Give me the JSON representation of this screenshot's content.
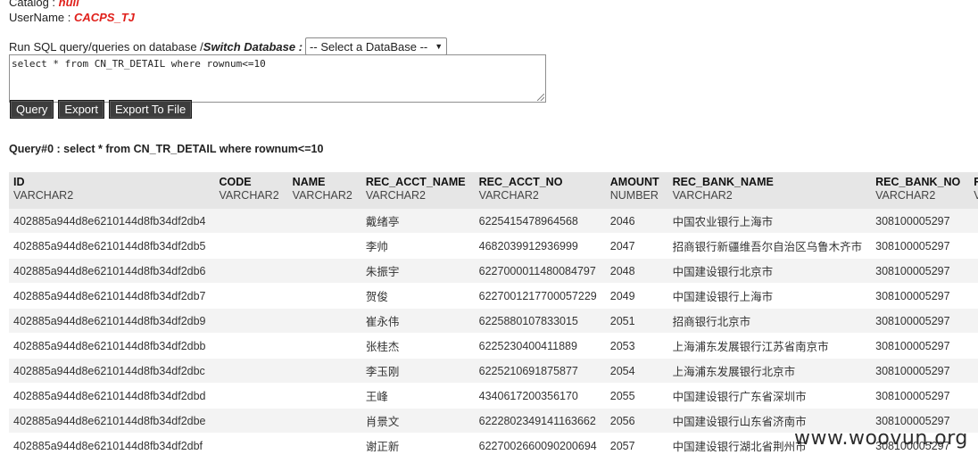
{
  "info": {
    "catalog_label": "Catalog : ",
    "catalog_value": "null",
    "username_label": "UserName : ",
    "username_value": "CACPS_TJ"
  },
  "run": {
    "label": "Run SQL query/queries on database / ",
    "switch_label": "Switch Database :",
    "select_value": "-- Select a DataBase --"
  },
  "sql": {
    "text": "select * from CN_TR_DETAIL where rownum<=10"
  },
  "buttons": {
    "query": "Query",
    "export": "Export",
    "export_file": "Export To File"
  },
  "query_title": "Query#0 : select * from CN_TR_DETAIL where rownum<=10",
  "table": {
    "columns": [
      {
        "name": "ID",
        "type": "VARCHAR2"
      },
      {
        "name": "CODE",
        "type": "VARCHAR2"
      },
      {
        "name": "NAME",
        "type": "VARCHAR2"
      },
      {
        "name": "REC_ACCT_NAME",
        "type": "VARCHAR2"
      },
      {
        "name": "REC_ACCT_NO",
        "type": "VARCHAR2"
      },
      {
        "name": "AMOUNT",
        "type": "NUMBER"
      },
      {
        "name": "REC_BANK_NAME",
        "type": "VARCHAR2"
      },
      {
        "name": "REC_BANK_NO",
        "type": "VARCHAR2"
      },
      {
        "name": "RE",
        "type": "VA"
      }
    ],
    "rows": [
      [
        "402885a944d8e6210144d8fb34df2db4",
        "",
        "",
        "戴绪亭",
        "6225415478964568",
        "2046",
        "中国农业银行上海市",
        "308100005297",
        ""
      ],
      [
        "402885a944d8e6210144d8fb34df2db5",
        "",
        "",
        "李帅",
        "4682039912936999",
        "2047",
        "招商银行新疆维吾尔自治区乌鲁木齐市",
        "308100005297",
        ""
      ],
      [
        "402885a944d8e6210144d8fb34df2db6",
        "",
        "",
        "朱振宇",
        "6227000011480084797",
        "2048",
        "中国建设银行北京市",
        "308100005297",
        ""
      ],
      [
        "402885a944d8e6210144d8fb34df2db7",
        "",
        "",
        "贺俊",
        "6227001217700057229",
        "2049",
        "中国建设银行上海市",
        "308100005297",
        ""
      ],
      [
        "402885a944d8e6210144d8fb34df2db9",
        "",
        "",
        "崔永伟",
        "6225880107833015",
        "2051",
        "招商银行北京市",
        "308100005297",
        ""
      ],
      [
        "402885a944d8e6210144d8fb34df2dbb",
        "",
        "",
        "张桂杰",
        "6225230400411889",
        "2053",
        "上海浦东发展银行江苏省南京市",
        "308100005297",
        ""
      ],
      [
        "402885a944d8e6210144d8fb34df2dbc",
        "",
        "",
        "李玉刚",
        "6225210691875877",
        "2054",
        "上海浦东发展银行北京市",
        "308100005297",
        ""
      ],
      [
        "402885a944d8e6210144d8fb34df2dbd",
        "",
        "",
        "王峰",
        "4340617200356170",
        "2055",
        "中国建设银行广东省深圳市",
        "308100005297",
        ""
      ],
      [
        "402885a944d8e6210144d8fb34df2dbe",
        "",
        "",
        "肖景文",
        "6222802349141163662",
        "2056",
        "中国建设银行山东省济南市",
        "308100005297",
        ""
      ],
      [
        "402885a944d8e6210144d8fb34df2dbf",
        "",
        "",
        "谢正新",
        "6227002660090200694",
        "2057",
        "中国建设银行湖北省荆州市",
        "308100005297",
        ""
      ]
    ]
  },
  "watermark": "www.woovun.org"
}
